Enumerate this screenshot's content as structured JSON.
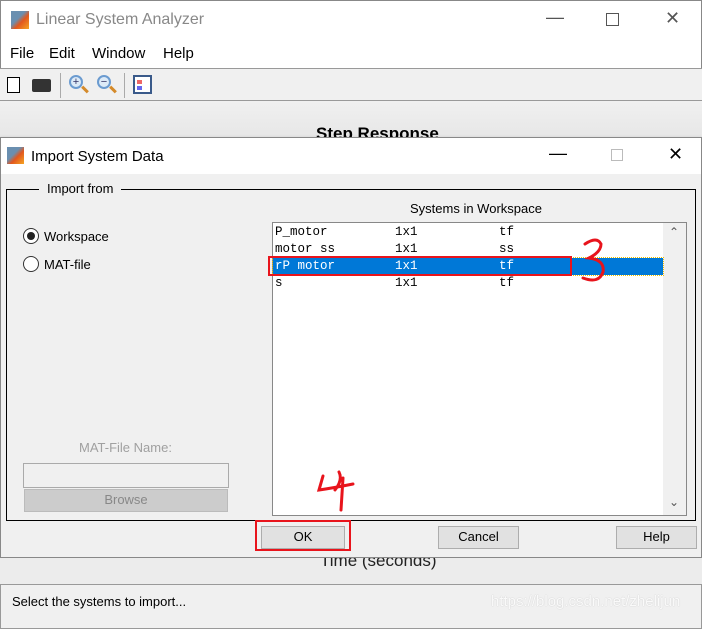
{
  "main_window": {
    "title": "Linear System Analyzer",
    "menu": [
      "File",
      "Edit",
      "Window",
      "Help"
    ],
    "toolbar_icons": [
      "new-icon",
      "print-icon",
      "zoom-in-icon",
      "zoom-out-icon",
      "legend-icon"
    ],
    "plot_title": "Step Response",
    "xlabel": "Time (seconds)",
    "status": "Select the systems to import...",
    "watermark": "https://blog.csdn.net/zhelijun"
  },
  "dialog": {
    "title": "Import System Data",
    "import_from_label": "Import from",
    "sources": [
      {
        "label": "Workspace",
        "selected": true
      },
      {
        "label": "MAT-file",
        "selected": false
      }
    ],
    "mat_file_label": "MAT-File Name:",
    "mat_file_value": "",
    "browse_label": "Browse",
    "list_header": "Systems in Workspace",
    "systems": [
      {
        "name": "P_motor",
        "size": "1x1",
        "type": "tf",
        "selected": false
      },
      {
        "name": "motor ss",
        "size": "1x1",
        "type": "ss",
        "selected": false
      },
      {
        "name": "rP motor",
        "size": "1x1",
        "type": "tf",
        "selected": true
      },
      {
        "name": "s",
        "size": "1x1",
        "type": "tf",
        "selected": false
      }
    ],
    "ok_label": "OK",
    "cancel_label": "Cancel",
    "help_label": "Help",
    "selection_color": "#0078d7",
    "annotation_color": "#e8141c",
    "annotations": [
      "3",
      "4"
    ]
  }
}
